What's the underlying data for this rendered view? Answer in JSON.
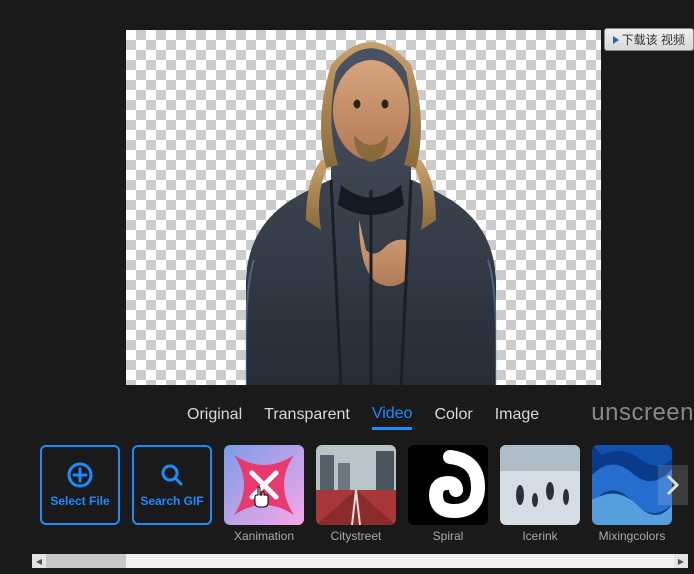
{
  "brand": "unscreen",
  "external_badge": {
    "label": "下载该 视频"
  },
  "tabs": {
    "items": [
      {
        "label": "Original",
        "active": false
      },
      {
        "label": "Transparent",
        "active": false
      },
      {
        "label": "Video",
        "active": true
      },
      {
        "label": "Color",
        "active": false
      },
      {
        "label": "Image",
        "active": false
      }
    ]
  },
  "actions": {
    "select_file": {
      "label": "Select File",
      "icon": "plus-circle-icon"
    },
    "search_gif": {
      "label": "Search GIF",
      "icon": "search-icon"
    }
  },
  "thumbnails": {
    "items": [
      {
        "label": "Xanimation",
        "icon": "x-anim"
      },
      {
        "label": "Citystreet",
        "icon": "city"
      },
      {
        "label": "Spiral",
        "icon": "spiral"
      },
      {
        "label": "Icerink",
        "icon": "ice"
      },
      {
        "label": "Mixingcolors",
        "icon": "mixing"
      }
    ]
  }
}
